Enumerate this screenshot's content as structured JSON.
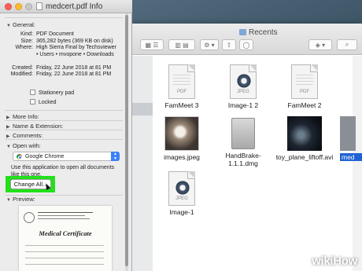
{
  "info_window": {
    "title": "medcert.pdf Info",
    "general": {
      "header": "General:",
      "fields": [
        {
          "key": "Kind:",
          "value": "PDF Document"
        },
        {
          "key": "Size:",
          "value": "365,282 bytes (369 KB on disk)"
        },
        {
          "key": "Where:",
          "value": "High Sierra Final by Techsviewer • Users • mvopone • Downloads"
        },
        {
          "key": "Created:",
          "value": "Friday, 22 June 2018 at 81 PM"
        },
        {
          "key": "Modified:",
          "value": "Friday, 22 June 2018 at 81 PM"
        }
      ],
      "stationery_pad": "Stationery pad",
      "locked": "Locked"
    },
    "sections": {
      "more_info": "More Info:",
      "name_extension": "Name & Extension:",
      "comments": "Comments:",
      "open_with": "Open with:",
      "preview": "Preview:"
    },
    "open_with": {
      "app": "Google Chrome",
      "note": "Use this application to open all documents like this one.",
      "change_all": "Change All..."
    },
    "preview_doc_title": "Medical Certificate"
  },
  "finder": {
    "title": "Recents",
    "files": [
      {
        "name": "FamMeet 3",
        "kind": "PDF",
        "thumb": "pdf-document-icon"
      },
      {
        "name": "Image-1 2",
        "kind": "JPEG",
        "thumb": "jpeg-document-icon"
      },
      {
        "name": "FamMeet 2",
        "kind": "PDF",
        "thumb": "pdf-document-icon"
      },
      {
        "name": "images.jpeg",
        "kind": "",
        "thumb": "cat-photo"
      },
      {
        "name": "HandBrake-1.1.1.dmg",
        "kind": "",
        "thumb": "disk-image-icon"
      },
      {
        "name": "toy_plane_liftoff.avi",
        "kind": "",
        "thumb": "video-thumbnail"
      },
      {
        "name": "Image-1",
        "kind": "JPEG",
        "thumb": "jpeg-document-icon"
      }
    ],
    "partial_label": "med"
  },
  "watermark": {
    "prefix": "wiki",
    "suffix": "How"
  },
  "colors": {
    "highlight": "#22e01a",
    "select_blue": "#3b82f6"
  }
}
